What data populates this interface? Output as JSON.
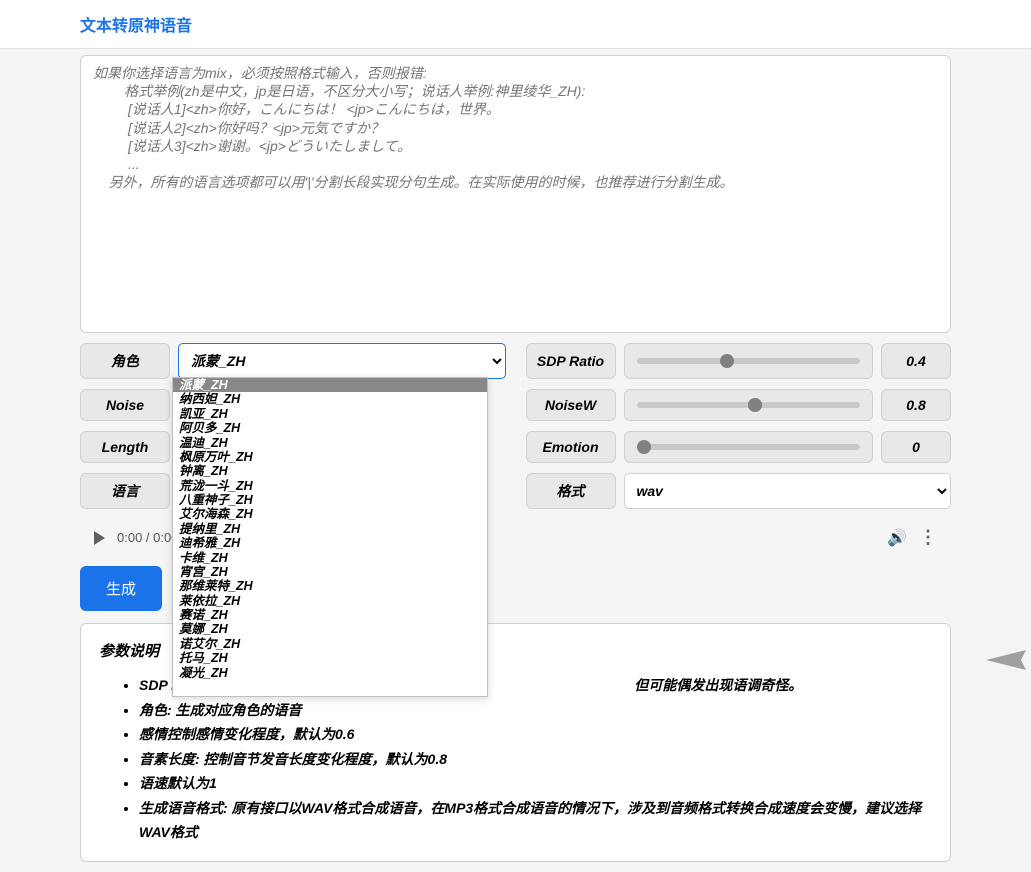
{
  "header": {
    "title": "文本转原神语音"
  },
  "textarea": {
    "placeholder": "如果你选择语言为mix，必须按照格式输入，否则报错:\n        格式举例(zh是中文，jp是日语，不区分大小写；说话人举例:神里绫华_ZH):\n         [说话人1]<zh>你好，こんにちは！ <jp>こんにちは，世界。\n         [说话人2]<zh>你好吗？<jp>元気ですか？\n         [说话人3]<zh>谢谢。<jp>どういたしまして。\n         ...\n    另外，所有的语言选项都可以用'|'分割长段实现分句生成。在实际使用的时候，也推荐进行分割生成。"
  },
  "controls": {
    "role": {
      "label": "角色",
      "value": "派蒙_ZH"
    },
    "sdp": {
      "label": "SDP Ratio",
      "value": "0.4"
    },
    "noise": {
      "label": "Noise",
      "value": ""
    },
    "noisew": {
      "label": "NoiseW",
      "value": "0.8"
    },
    "length": {
      "label": "Length",
      "value": ""
    },
    "emotion": {
      "label": "Emotion",
      "value": "0"
    },
    "language": {
      "label": "语言",
      "value": ""
    },
    "format": {
      "label": "格式",
      "value": "wav"
    }
  },
  "dropdown_options": [
    "派蒙_ZH",
    "纳西妲_ZH",
    "凯亚_ZH",
    "阿贝多_ZH",
    "温迪_ZH",
    "枫原万叶_ZH",
    "钟离_ZH",
    "荒泷一斗_ZH",
    "八重神子_ZH",
    "艾尔海森_ZH",
    "提纳里_ZH",
    "迪希雅_ZH",
    "卡维_ZH",
    "宵宫_ZH",
    "那维莱特_ZH",
    "莱依拉_ZH",
    "赛诺_ZH",
    "莫娜_ZH",
    "诺艾尔_ZH",
    "托马_ZH",
    "凝光_ZH"
  ],
  "audio": {
    "time": "0:00 / 0:00"
  },
  "generate_btn": "生成",
  "params": {
    "title": "参数说明",
    "items": [
      "SDP Ratio",
      "但可能偶发出现语调奇怪。",
      "角色: 生成对应角色的语音",
      "感情控制感情变化程度，默认为0.6",
      "音素长度: 控制音节发音长度变化程度，默认为0.8",
      "语速默认为1",
      "生成语音格式: 原有接口以WAV格式合成语音，在MP3格式合成语音的情况下，涉及到音频格式转换合成速度会变慢，建议选择WAV格式"
    ]
  }
}
